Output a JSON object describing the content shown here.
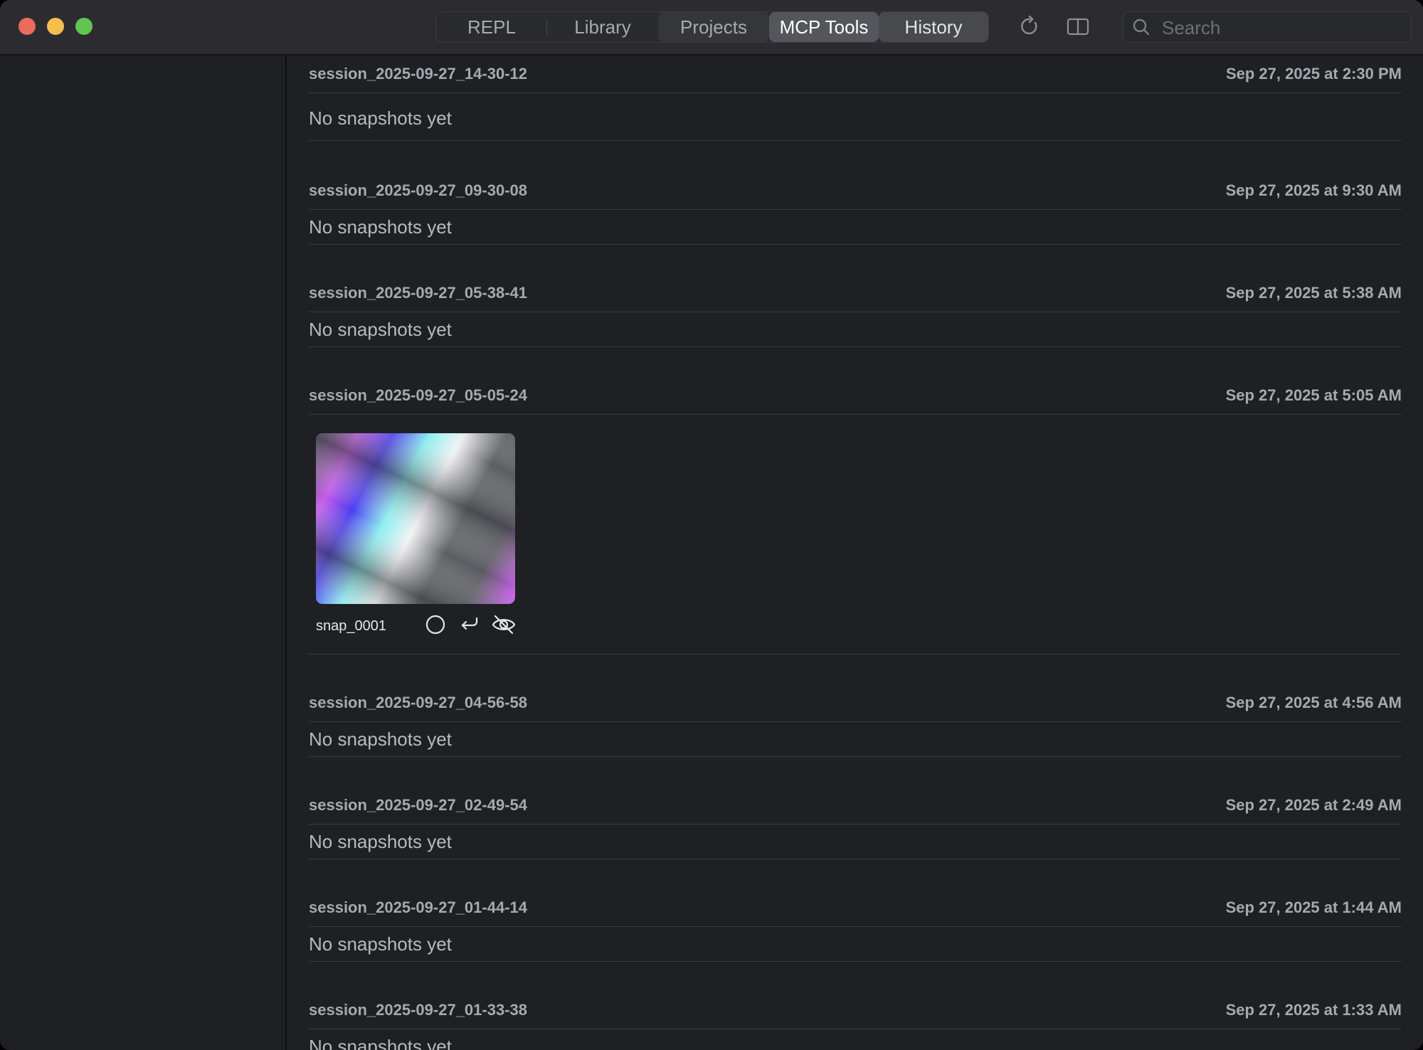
{
  "tabs": [
    {
      "label": "REPL"
    },
    {
      "label": "Library"
    },
    {
      "label": "Projects"
    },
    {
      "label": "MCP Tools"
    },
    {
      "label": "History"
    }
  ],
  "search": {
    "placeholder": "Search"
  },
  "icons": {
    "refresh": "refresh-icon",
    "sidebar": "sidebar-toggle-icon",
    "search": "search-icon",
    "select": "circle-icon",
    "restore": "return-arrow-icon",
    "hide": "eye-slash-icon"
  },
  "sessions": [
    {
      "name": "session_2025-09-27_14-30-12",
      "date": "Sep 27, 2025 at 2:30 PM",
      "empty_text": "No snapshots yet"
    },
    {
      "name": "session_2025-09-27_09-30-08",
      "date": "Sep 27, 2025 at 9:30 AM",
      "empty_text": "No snapshots yet"
    },
    {
      "name": "session_2025-09-27_05-38-41",
      "date": "Sep 27, 2025 at 5:38 AM",
      "empty_text": "No snapshots yet"
    },
    {
      "name": "session_2025-09-27_05-05-24",
      "date": "Sep 27, 2025 at 5:05 AM",
      "snapshots": [
        {
          "name": "snap_0001"
        }
      ]
    },
    {
      "name": "session_2025-09-27_04-56-58",
      "date": "Sep 27, 2025 at 4:56 AM",
      "empty_text": "No snapshots yet"
    },
    {
      "name": "session_2025-09-27_02-49-54",
      "date": "Sep 27, 2025 at 2:49 AM",
      "empty_text": "No snapshots yet"
    },
    {
      "name": "session_2025-09-27_01-44-14",
      "date": "Sep 27, 2025 at 1:44 AM",
      "empty_text": "No snapshots yet"
    },
    {
      "name": "session_2025-09-27_01-33-38",
      "date": "Sep 27, 2025 at 1:33 AM",
      "empty_text": "No snapshots yet"
    }
  ]
}
